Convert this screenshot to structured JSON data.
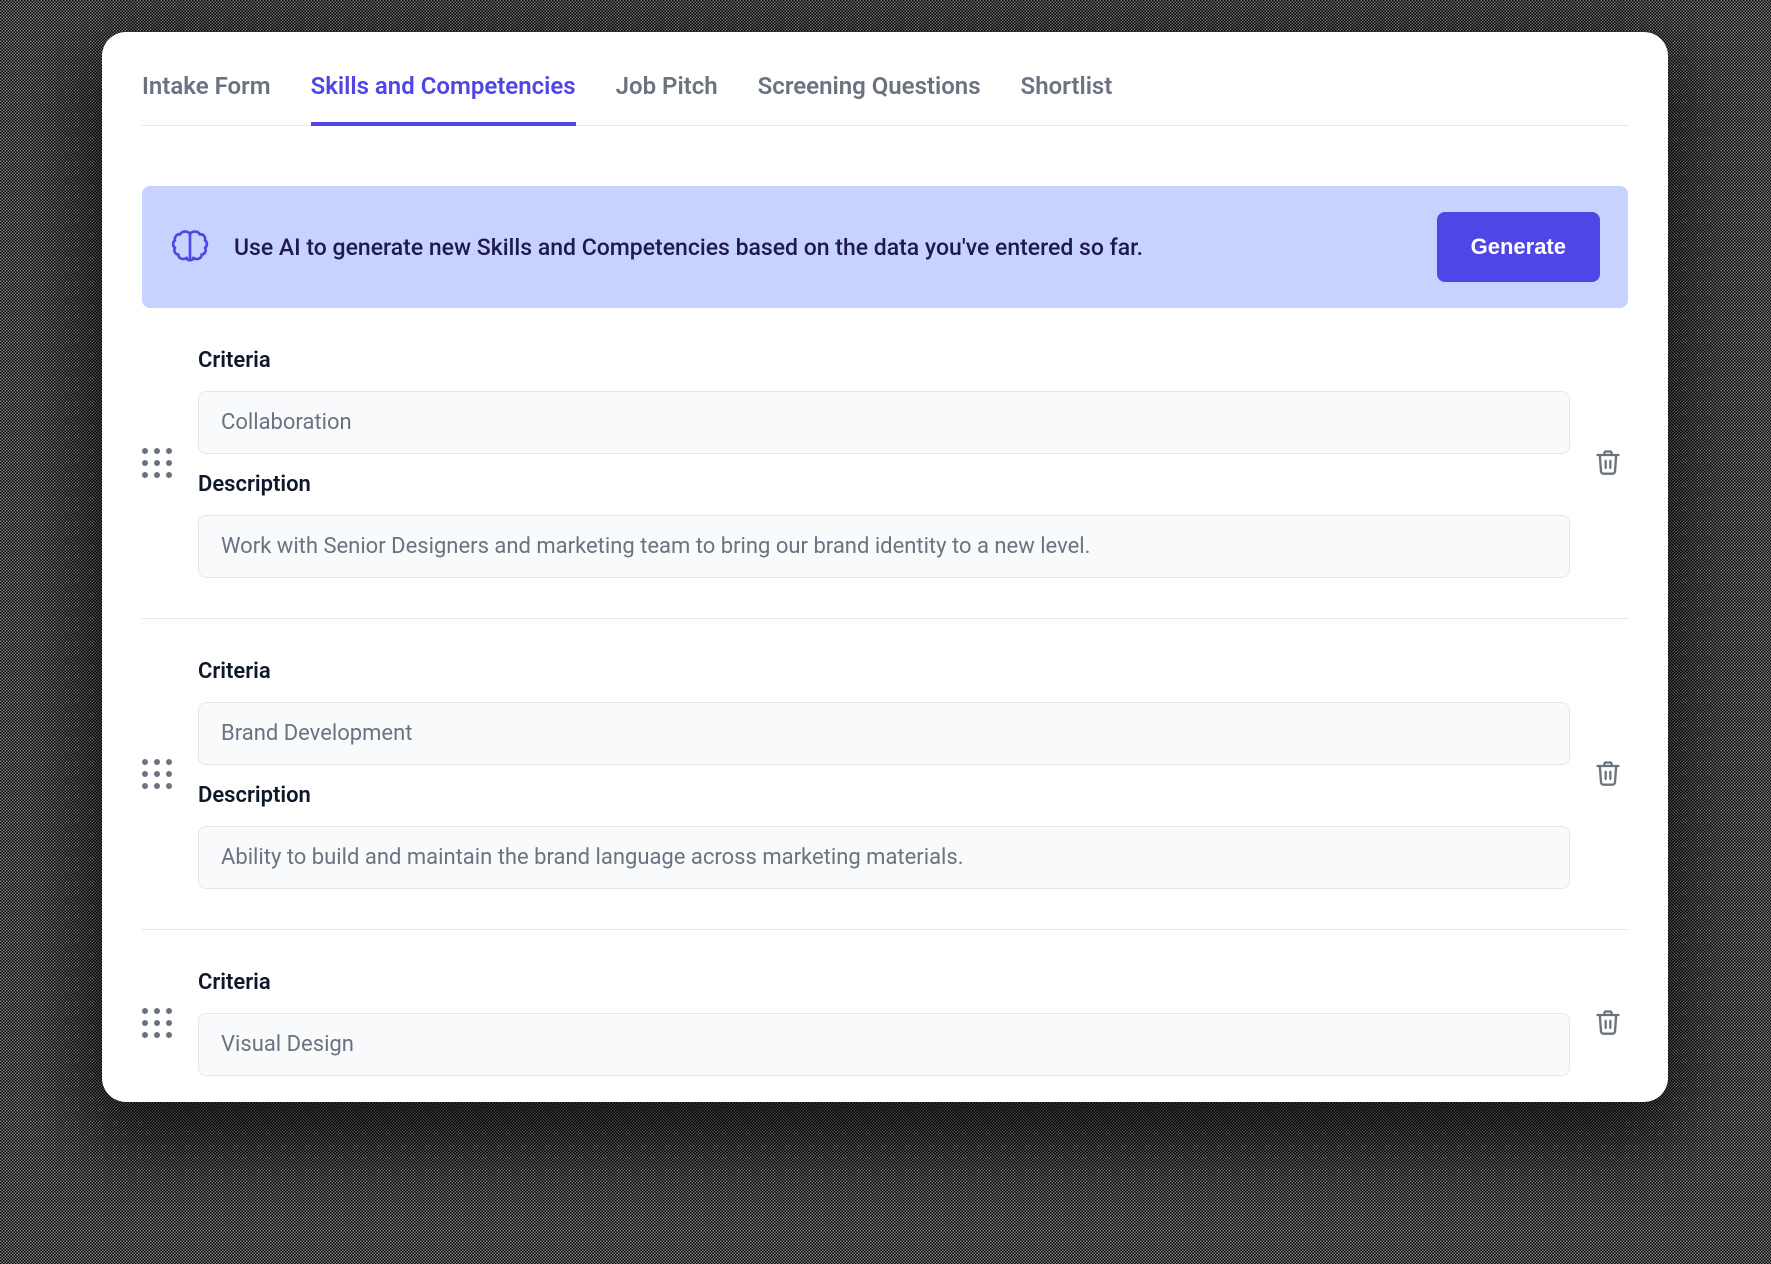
{
  "tabs": [
    {
      "label": "Intake Form",
      "active": false
    },
    {
      "label": "Skills and Competencies",
      "active": true
    },
    {
      "label": "Job Pitch",
      "active": false
    },
    {
      "label": "Screening Questions",
      "active": false
    },
    {
      "label": "Shortlist",
      "active": false
    }
  ],
  "ai_banner": {
    "text": "Use AI to generate new Skills and Competencies based on the data you've entered so far.",
    "button_label": "Generate"
  },
  "labels": {
    "criteria": "Criteria",
    "description": "Description"
  },
  "items": [
    {
      "criteria": "Collaboration",
      "description": "Work with Senior Designers and marketing team to bring our brand identity to a new level."
    },
    {
      "criteria": "Brand Development",
      "description": "Ability to build and maintain the brand language across marketing materials."
    },
    {
      "criteria": "Visual Design",
      "description": ""
    }
  ]
}
